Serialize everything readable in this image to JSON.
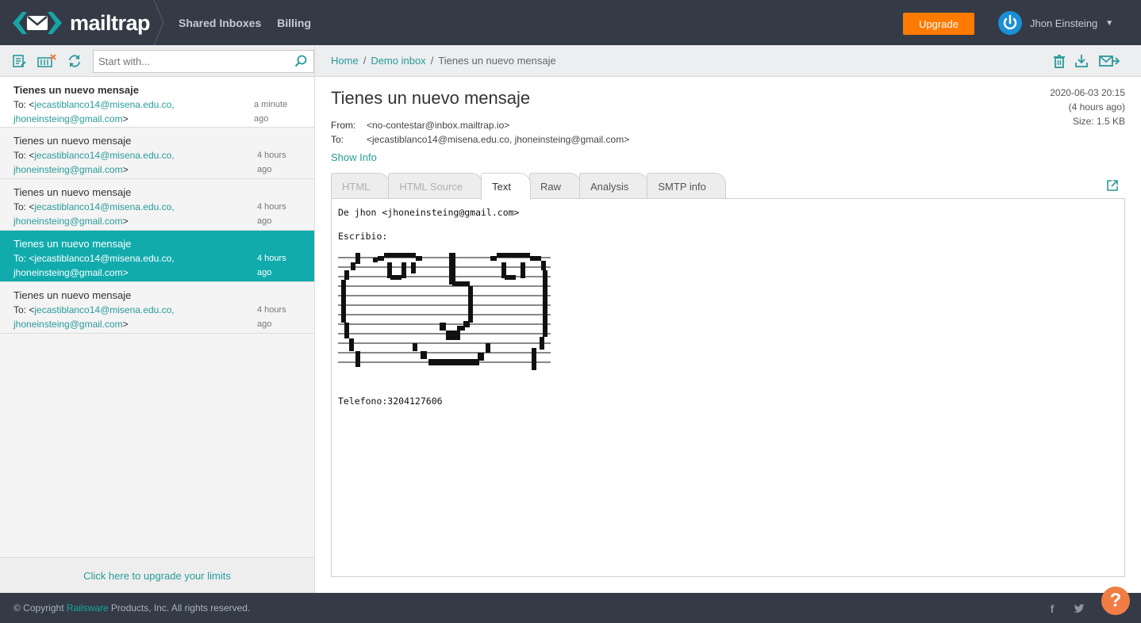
{
  "brand": {
    "name": "mailtrap",
    "accent": "#11abad",
    "topbar_bg": "#343b46",
    "upgrade_color": "#ff7a00"
  },
  "topnav": {
    "shared_inboxes": "Shared Inboxes",
    "billing": "Billing",
    "upgrade": "Upgrade",
    "user_name": "Jhon Einsteing"
  },
  "left_toolbar": {
    "icons": [
      "edit-inbox-icon",
      "clean-inbox-icon",
      "refresh-icon"
    ],
    "search_placeholder": "Start with..."
  },
  "messages": [
    {
      "subject": "Tienes un nuevo mensaje",
      "to_prefix": "To: <",
      "addr1": "jecastiblanco14@misena.edu.co,",
      "addr2": "jhoneinsteing@gmail.com",
      "to_suffix": ">",
      "time1": "a minute",
      "time2": "ago",
      "unread": true,
      "active": false
    },
    {
      "subject": "Tienes un nuevo mensaje",
      "to_prefix": "To: <",
      "addr1": "jecastiblanco14@misena.edu.co,",
      "addr2": "jhoneinsteing@gmail.com",
      "to_suffix": ">",
      "time1": "4 hours",
      "time2": "ago",
      "unread": false,
      "active": false
    },
    {
      "subject": "Tienes un nuevo mensaje",
      "to_prefix": "To: <",
      "addr1": "jecastiblanco14@misena.edu.co,",
      "addr2": "jhoneinsteing@gmail.com",
      "to_suffix": ">",
      "time1": "4 hours",
      "time2": "ago",
      "unread": false,
      "active": false
    },
    {
      "subject": "Tienes un nuevo mensaje",
      "to_prefix": "To: <",
      "addr1": "jecastiblanco14@misena.edu.co,",
      "addr2": "jhoneinsteing@gmail.com",
      "to_suffix": ">",
      "time1": "4 hours",
      "time2": "ago",
      "unread": false,
      "active": true
    },
    {
      "subject": "Tienes un nuevo mensaje",
      "to_prefix": "To: <",
      "addr1": "jecastiblanco14@misena.edu.co,",
      "addr2": "jhoneinsteing@gmail.com",
      "to_suffix": ">",
      "time1": "4 hours",
      "time2": "ago",
      "unread": false,
      "active": false
    }
  ],
  "upgrade_limits": "Click here to upgrade your limits",
  "breadcrumb": {
    "home": "Home",
    "inbox": "Demo inbox",
    "current": "Tienes un nuevo mensaje",
    "separator": "/"
  },
  "right_toolbar_icons": [
    "trash-icon",
    "download-icon",
    "forward-icon"
  ],
  "message": {
    "subject": "Tienes un nuevo mensaje",
    "date": "2020-06-03 20:15",
    "relative": "(4 hours ago)",
    "size": "Size: 1.5 KB",
    "from_label": "From:",
    "from": "<no-contestar@inbox.mailtrap.io>",
    "to_label": "To:",
    "to": "<jecastiblanco14@misena.edu.co, jhoneinsteing@gmail.com>",
    "show_info": "Show Info"
  },
  "tabs": [
    {
      "label": "HTML",
      "state": "disabled"
    },
    {
      "label": "HTML Source",
      "state": "disabled"
    },
    {
      "label": "Text",
      "state": "active"
    },
    {
      "label": "Raw",
      "state": "enabled"
    },
    {
      "label": "Analysis",
      "state": "enabled"
    },
    {
      "label": "SMTP info",
      "state": "enabled"
    }
  ],
  "body": {
    "line1": "De jhon <jhoneinsteing@gmail.com>",
    "line2": "Escribio:",
    "ascii_art": "smiley-face-ascii-art",
    "phone": "Telefono:3204127606"
  },
  "footer": {
    "copy_prefix": "© Copyright ",
    "company": "Railsware",
    "copy_suffix": " Products, Inc. All rights reserved.",
    "facebook": "f",
    "help": "?"
  }
}
